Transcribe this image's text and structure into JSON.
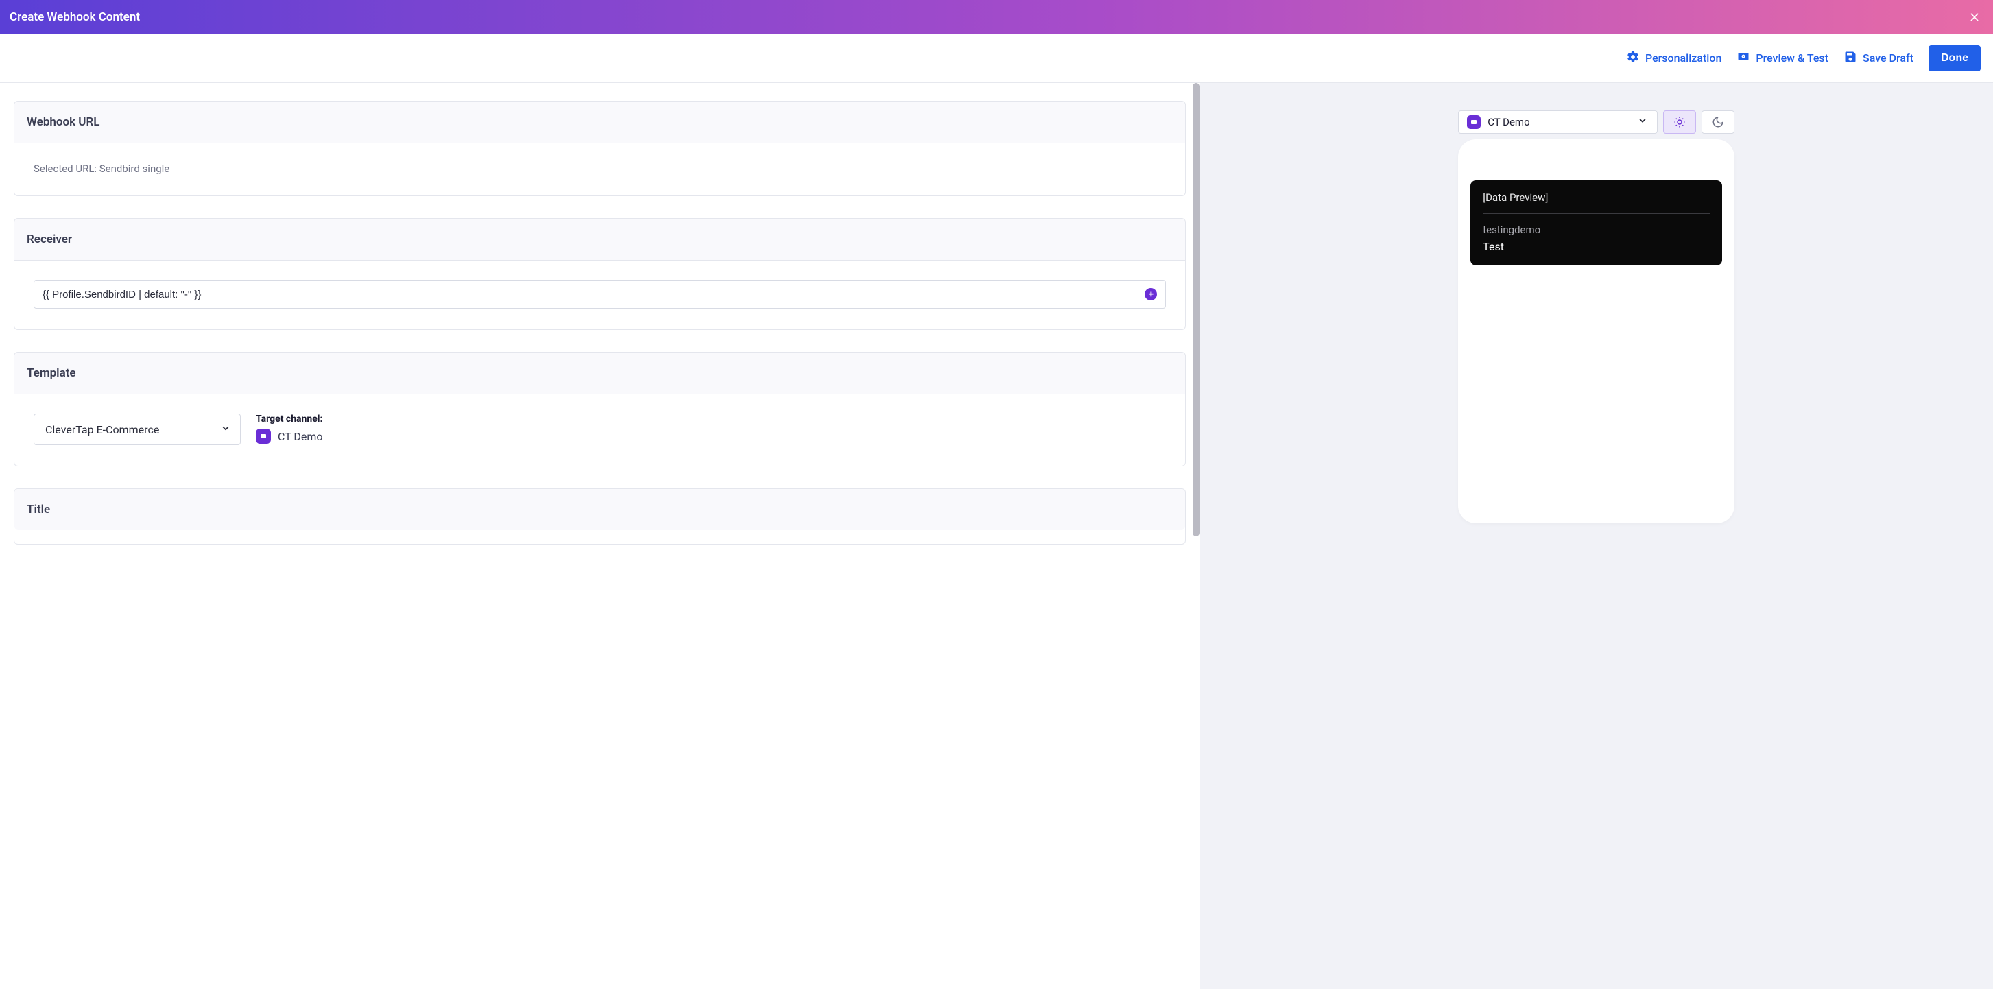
{
  "header": {
    "title": "Create Webhook Content"
  },
  "toolbar": {
    "personalization": "Personalization",
    "preview_test": "Preview & Test",
    "save_draft": "Save Draft",
    "done": "Done"
  },
  "sections": {
    "webhook_url": {
      "title": "Webhook URL",
      "selected": "Selected URL: Sendbird single"
    },
    "receiver": {
      "title": "Receiver",
      "value": "{{ Profile.SendbirdID | default: \"-\" }}"
    },
    "template": {
      "title": "Template",
      "selected": "CleverTap E-Commerce",
      "target_label": "Target channel:",
      "channel_name": "CT Demo"
    },
    "title_section": {
      "title": "Title"
    }
  },
  "preview": {
    "selected_channel": "CT Demo",
    "card_title": "[Data Preview]",
    "sender": "testingdemo",
    "message": "Test"
  }
}
